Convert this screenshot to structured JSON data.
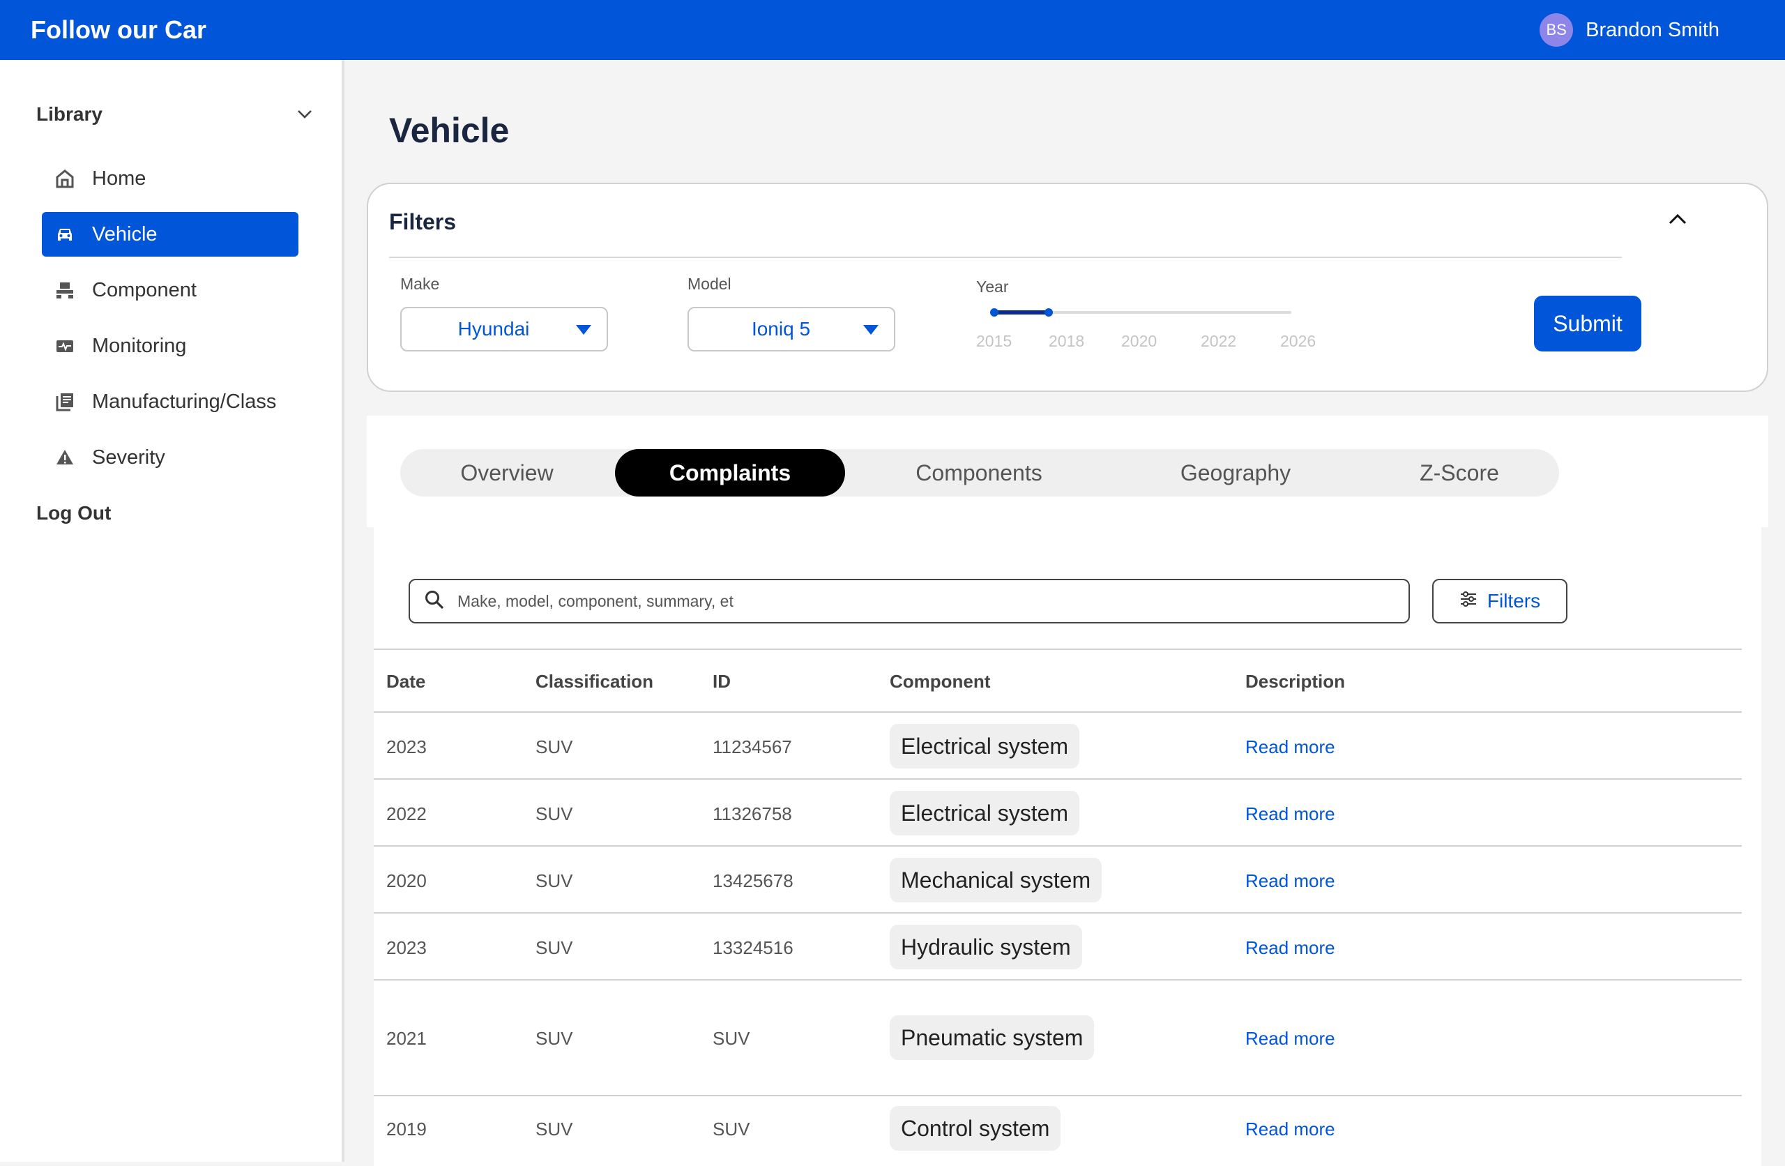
{
  "app": {
    "title": "Follow our Car"
  },
  "user": {
    "initials": "BS",
    "name": "Brandon Smith"
  },
  "sidebar": {
    "section_title": "Library",
    "items": [
      {
        "label": "Home",
        "icon": "home-icon",
        "active": false
      },
      {
        "label": "Vehicle",
        "icon": "car-icon",
        "active": true
      },
      {
        "label": "Component",
        "icon": "component-icon",
        "active": false
      },
      {
        "label": "Monitoring",
        "icon": "monitoring-icon",
        "active": false
      },
      {
        "label": "Manufacturing/Class",
        "icon": "library-books-icon",
        "active": false
      },
      {
        "label": "Severity",
        "icon": "warning-icon",
        "active": false
      }
    ],
    "logout_label": "Log Out"
  },
  "page": {
    "title": "Vehicle"
  },
  "filters": {
    "title": "Filters",
    "make_label": "Make",
    "make_value": "Hyundai",
    "model_label": "Model",
    "model_value": "Ioniq 5",
    "year_label": "Year",
    "year_ticks": [
      "2015",
      "2018",
      "2020",
      "2022",
      "2026"
    ],
    "year_range": [
      2015,
      2018
    ],
    "submit_label": "Submit"
  },
  "tabs": [
    {
      "label": "Overview",
      "active": false
    },
    {
      "label": "Complaints",
      "active": true
    },
    {
      "label": "Components",
      "active": false
    },
    {
      "label": "Geography",
      "active": false
    },
    {
      "label": "Z-Score",
      "active": false
    }
  ],
  "search": {
    "placeholder": "Make, model, component, summary, et"
  },
  "filters_button_label": "Filters",
  "table": {
    "headers": [
      "Date",
      "Classification",
      "ID",
      "Component",
      "Description"
    ],
    "rows": [
      {
        "date": "2023",
        "classification": "SUV",
        "id": "11234567",
        "component": "Electrical system",
        "description": "Read more"
      },
      {
        "date": "2022",
        "classification": "SUV",
        "id": "11326758",
        "component": "Electrical system",
        "description": "Read more"
      },
      {
        "date": "2020",
        "classification": "SUV",
        "id": "13425678",
        "component": "Mechanical system",
        "description": "Read more"
      },
      {
        "date": "2023",
        "classification": "SUV",
        "id": "13324516",
        "component": "Hydraulic system",
        "description": "Read more"
      },
      {
        "date": "2021",
        "classification": "SUV",
        "id": "SUV",
        "component": "Pneumatic system",
        "description": "Read more"
      },
      {
        "date": "2019",
        "classification": "SUV",
        "id": "SUV",
        "component": "Control system",
        "description": "Read more"
      }
    ]
  },
  "colors": {
    "primary": "#0055d9",
    "active_tab": "#000000",
    "avatar": "#8d86e8"
  }
}
